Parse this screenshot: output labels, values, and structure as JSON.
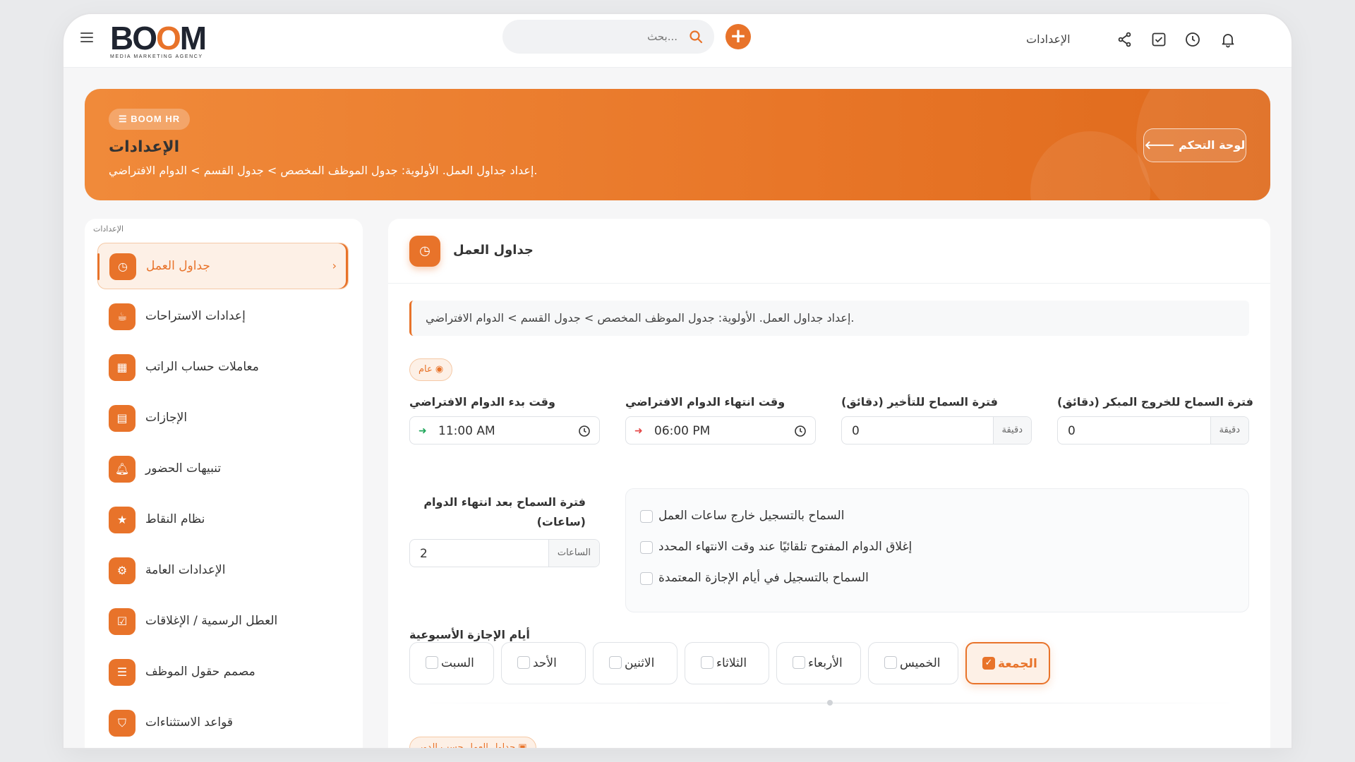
{
  "topbar": {
    "logo_main": "BOOM",
    "logo_sub": "MEDIA MARKETING AGENCY",
    "search_placeholder": "...بحث",
    "add_symbol": "+",
    "settings_label": "الإعدادات"
  },
  "banner": {
    "tag": "BOOM HR",
    "title": "الإعدادات",
    "description": ".إعداد جداول العمل. الأولوية: جدول الموظف المخصص > جدول القسم > الدوام الافتراضي",
    "dashboard_button": "لوحة التحكم"
  },
  "sidebar": {
    "title": "الإعدادات",
    "items": [
      {
        "label": "جداول العمل",
        "icon": "clock-icon",
        "active": true
      },
      {
        "label": "إعدادات الاستراحات",
        "icon": "coffee-icon",
        "active": false
      },
      {
        "label": "معاملات حساب الراتب",
        "icon": "calculator-icon",
        "active": false
      },
      {
        "label": "الإجازات",
        "icon": "calendar-icon",
        "active": false
      },
      {
        "label": "تنبيهات الحضور",
        "icon": "bell-icon",
        "active": false
      },
      {
        "label": "نظام النقاط",
        "icon": "star-icon",
        "active": false
      },
      {
        "label": "الإعدادات العامة",
        "icon": "gear-icon",
        "active": false
      },
      {
        "label": "العطل الرسمية / الإغلاقات",
        "icon": "calendar-check-icon",
        "active": false
      },
      {
        "label": "مصمم حقول الموظف",
        "icon": "list-icon",
        "active": false
      },
      {
        "label": "قواعد الاستثناءات",
        "icon": "shield-icon",
        "active": false
      }
    ]
  },
  "panel": {
    "title": "جداول العمل",
    "info": ".إعداد جداول العمل. الأولوية: جدول الموظف المخصص > جدول القسم > الدوام الافتراضي",
    "general_pill": "عام",
    "fields": {
      "start_label": "وقت بدء الدوام الافتراضي",
      "start_value": "11:00 AM",
      "end_label": "وقت انتهاء الدوام الافتراضي",
      "end_value": "06:00 PM",
      "late_label": "فترة السماح للتأخير (دقائق)",
      "late_value": "0",
      "early_label": "فترة السماح للخروج المبكر (دقائق)",
      "early_value": "0",
      "minute_unit": "دقيقة",
      "after_end_label": "فترة السماح بعد انتهاء الدوام (ساعات)",
      "after_end_value": "2",
      "hours_unit": "الساعات"
    },
    "checks": [
      "السماح بالتسجيل خارج ساعات العمل",
      "إغلاق الدوام المفتوح تلقائيًا عند وقت الانتهاء المحدد",
      "السماح بالتسجيل في أيام الإجازة المعتمدة"
    ],
    "weekend_label": "أيام الإجازة الأسبوعية",
    "days": [
      {
        "label": "الجمعة",
        "checked": true
      },
      {
        "label": "الخميس",
        "checked": false
      },
      {
        "label": "الأربعاء",
        "checked": false
      },
      {
        "label": "الثلاثاء",
        "checked": false
      },
      {
        "label": "الاثنين",
        "checked": false
      },
      {
        "label": "الأحد",
        "checked": false
      },
      {
        "label": "السبت",
        "checked": false
      }
    ],
    "role_pill": "جداول العمل حسب الدور"
  },
  "colors": {
    "accent": "#e8732a",
    "accent_light": "#fdf0e6"
  }
}
